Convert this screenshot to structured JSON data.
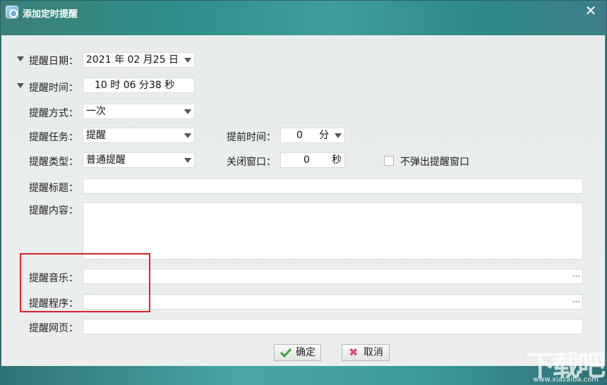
{
  "window": {
    "title": "添加定时提醒",
    "close_glyph": "✕",
    "icon": "reminder-app-icon"
  },
  "form": {
    "date": {
      "label": "提醒日期：",
      "value": "2021 年 02 月25 日"
    },
    "time": {
      "label": "提醒时间：",
      "value": "10  时 06 分38 秒"
    },
    "mode": {
      "label": "提醒方式：",
      "value": "一次"
    },
    "task": {
      "label": "提醒任务：",
      "value": "提醒"
    },
    "advance": {
      "label": "提前时间：",
      "value": "0",
      "unit": "分"
    },
    "type": {
      "label": "提醒类型：",
      "value": "普通提醒"
    },
    "close_window": {
      "label": "关闭窗口：",
      "value": "0",
      "unit": "秒"
    },
    "no_popup": {
      "label": "不弹出提醒窗口",
      "checked": false
    },
    "title": {
      "label": "提醒标题：",
      "value": ""
    },
    "content": {
      "label": "提醒内容：",
      "value": ""
    },
    "music": {
      "label": "提醒音乐：",
      "value": "",
      "browse": "···"
    },
    "program": {
      "label": "提醒程序：",
      "value": "",
      "browse": "···"
    },
    "webpage": {
      "label": "提醒网页：",
      "value": ""
    }
  },
  "buttons": {
    "ok": "确定",
    "cancel": "取消"
  },
  "watermark": {
    "main": "下载吧",
    "sub": "www.xiazaiba.com"
  },
  "colors": {
    "highlight": "#d8232a",
    "ok_check": "#3aa33a",
    "cancel_x": "#e0477a"
  }
}
